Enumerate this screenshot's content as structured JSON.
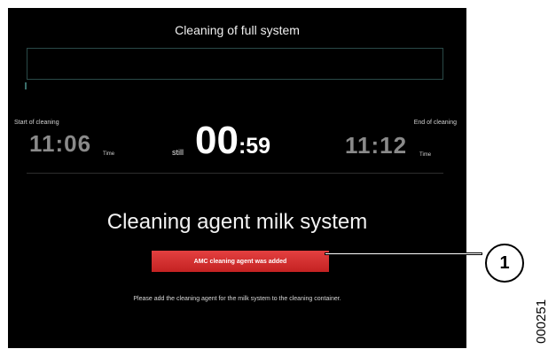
{
  "screen": {
    "title": "Cleaning of full system",
    "progress_fraction": 0.0
  },
  "start": {
    "caption": "Start of cleaning",
    "time": "11:06",
    "unit": "Time"
  },
  "countdown": {
    "prefix": "still",
    "minutes": "00",
    "seconds": ":59"
  },
  "end": {
    "caption": "End of cleaning",
    "time": "11:12",
    "unit": "Time"
  },
  "section": {
    "heading": "Cleaning agent milk system",
    "button_label": "AMC cleaning agent was added",
    "instruction": "Please add the cleaning agent for the milk system to the cleaning container."
  },
  "callout": {
    "number": "1"
  },
  "figure_id": "000251",
  "colors": {
    "screen_background": "#000000",
    "button": "#d63030",
    "progress_border": "#2a4a48"
  }
}
